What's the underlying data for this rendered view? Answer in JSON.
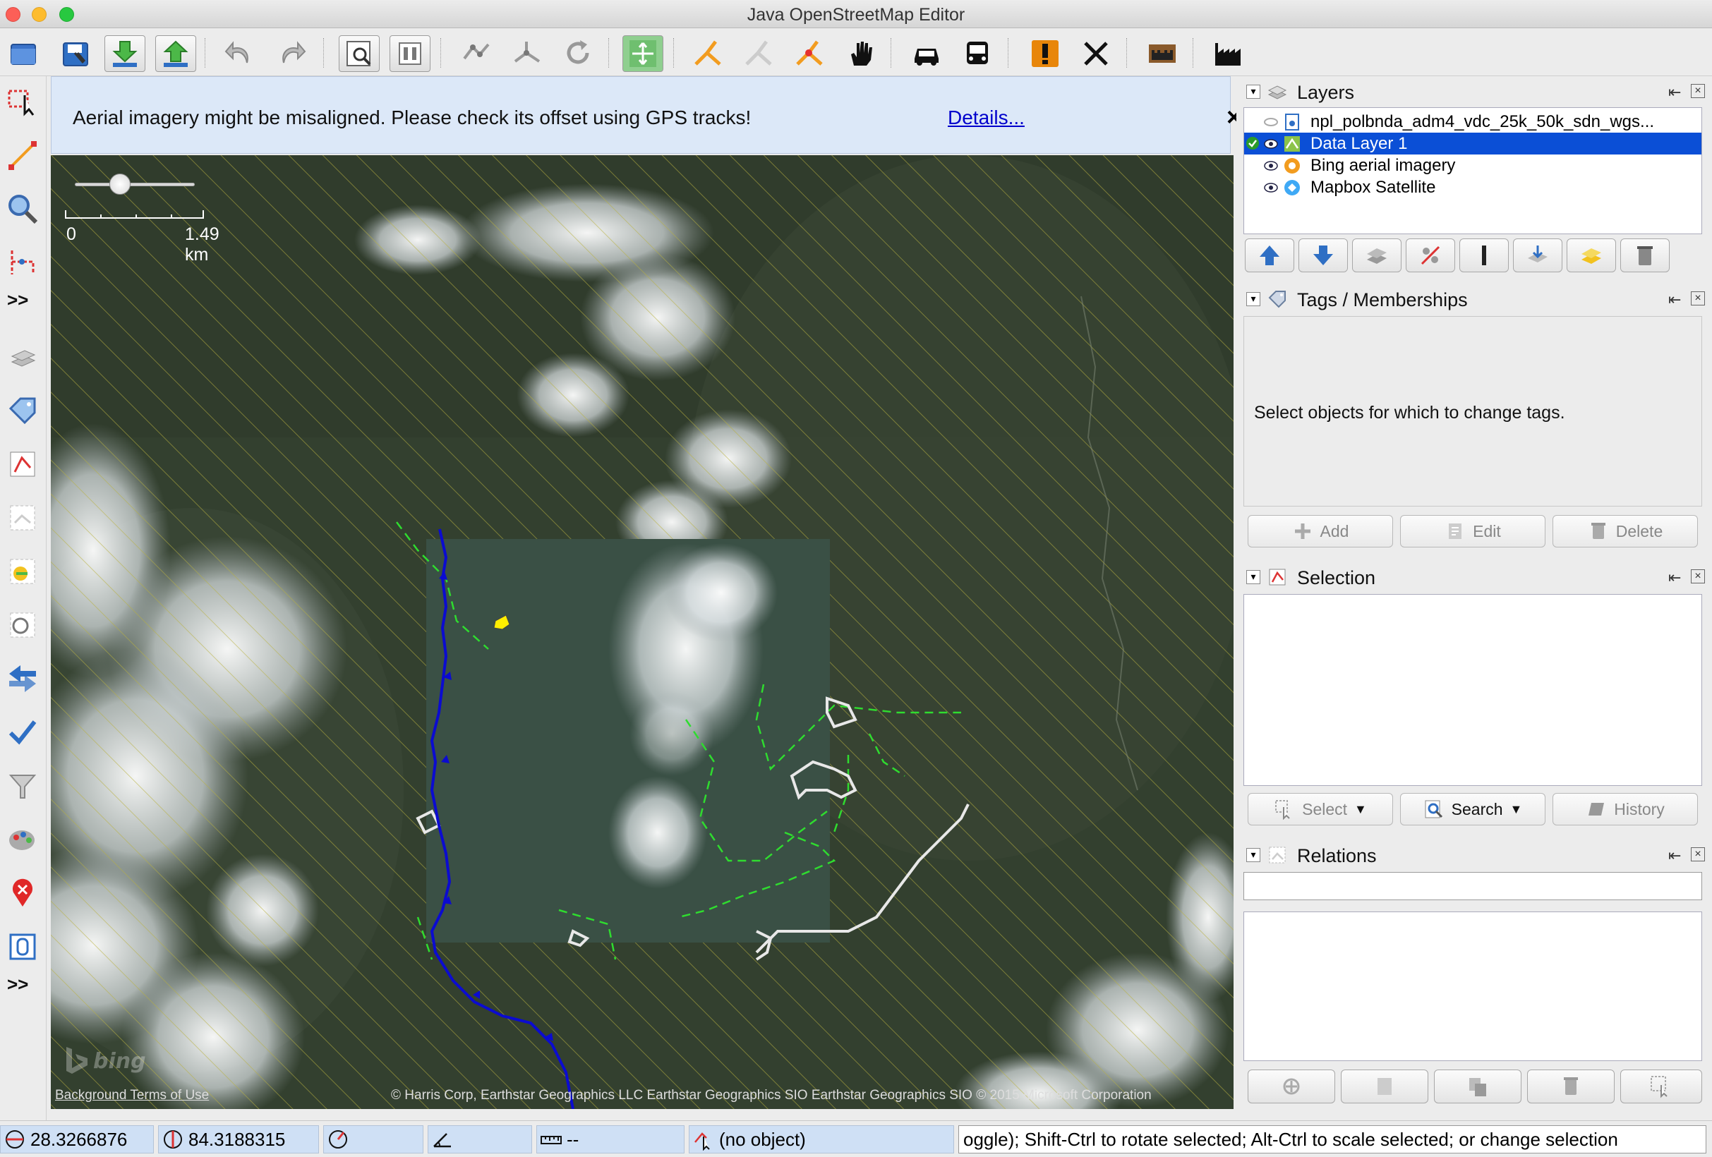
{
  "window": {
    "title": "Java OpenStreetMap Editor"
  },
  "notice": {
    "text": "Aerial imagery might be misaligned. Please check its offset using GPS tracks!",
    "link": "Details...",
    "close": "×"
  },
  "toolbar": {
    "icons": [
      "open-file-icon",
      "save-icon",
      "download-icon",
      "upload-icon",
      "undo-icon",
      "redo-icon",
      "zoom-preferences-icon",
      "data-filter-icon",
      "simplify-way-icon",
      "split-way-icon",
      "refresh-icon",
      "imagery-offset-icon",
      "combine-way-icon",
      "unglue-icon",
      "split-nodes-icon",
      "hand-move-icon",
      "car-icon",
      "bus-icon",
      "warning-icon",
      "cross-tools-icon",
      "castle-icon",
      "factory-icon"
    ]
  },
  "lefttools": {
    "more_label": ">>"
  },
  "map": {
    "scale_zero": "0",
    "scale_distance": "1.49 km",
    "bing_logo": "bing",
    "terms_link": "Background Terms of Use",
    "attribution": "© Harris Corp, Earthstar Geographics LLC Earthstar Geographics  SIO Earthstar Geographics  SIO © 2015 Microsoft Corporation",
    "zoom_level": 0.35
  },
  "layers": {
    "title": "Layers",
    "items": [
      {
        "name": "npl_polbnda_adm4_vdc_25k_50k_sdn_wgs...",
        "visible": false,
        "selected": false,
        "active": false
      },
      {
        "name": "Data Layer 1",
        "visible": true,
        "selected": true,
        "active": true
      },
      {
        "name": "Bing aerial imagery",
        "visible": true,
        "selected": false,
        "active": false
      },
      {
        "name": "Mapbox Satellite",
        "visible": true,
        "selected": false,
        "active": false
      }
    ]
  },
  "tags": {
    "title": "Tags / Memberships",
    "empty_text": "Select objects for which to change tags.",
    "add": "Add",
    "edit": "Edit",
    "delete": "Delete"
  },
  "selection": {
    "title": "Selection",
    "select": "Select",
    "search": "Search",
    "history": "History"
  },
  "relations": {
    "title": "Relations",
    "filter_value": ""
  },
  "status": {
    "lat": "28.3266876",
    "lon": "84.3188315",
    "heading": "",
    "angle": "",
    "distance": "--",
    "object": "(no object)",
    "help": "oggle); Shift-Ctrl to rotate selected; Alt-Ctrl to scale selected; or change selection"
  },
  "colors": {
    "selection_blue": "#0b4fd6",
    "notice_bg": "#dce8f8",
    "boundary_line": "#0000cc",
    "track_green": "#22cc22"
  }
}
